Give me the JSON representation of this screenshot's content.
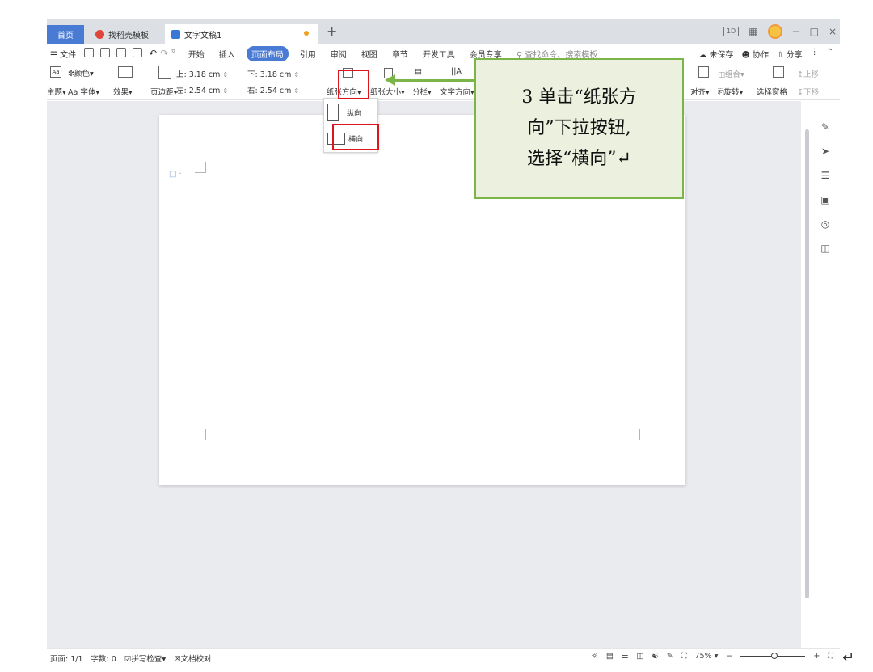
{
  "tabs": {
    "home": "首页",
    "template": "找稻壳模板",
    "document": "文字文稿1",
    "add": "+"
  },
  "window": {
    "layout_label": "1D",
    "grid_icon": "grid-icon",
    "minimize": "−",
    "restore": "□",
    "close": "×"
  },
  "menu": {
    "file": "文件",
    "items": [
      "开始",
      "插入",
      "页面布局",
      "引用",
      "审阅",
      "视图",
      "章节",
      "开发工具",
      "会员专享"
    ],
    "active": "页面布局",
    "search_placeholder": "查找命令、搜索模板",
    "unsaved": "未保存",
    "collaborate": "协作",
    "share": "分享"
  },
  "ribbon": {
    "theme": "主题",
    "color": "颜色",
    "font": "字体",
    "effect": "效果",
    "margins": "页边距",
    "margin_top_label": "上:",
    "margin_top": "3.18 cm",
    "margin_bottom_label": "下:",
    "margin_bottom": "3.18 cm",
    "margin_left_label": "左:",
    "margin_left": "2.54 cm",
    "margin_right_label": "右:",
    "margin_right": "2.54 cm",
    "orientation": "纸张方向",
    "paper_size": "纸张大小",
    "columns": "分栏",
    "text_direction": "文字方向",
    "group": "组合",
    "align": "对齐",
    "rotate": "旋转",
    "selection_pane": "选择窗格",
    "move_up": "上移",
    "move_down": "下移"
  },
  "dropdown": {
    "portrait": "纵向",
    "landscape": "横向"
  },
  "callout": {
    "line1": "3 单击“纸张方",
    "line2": "向”下拉按钮,",
    "line3": "选择“横向”↵"
  },
  "status": {
    "page": "页面: 1/1",
    "word_count": "字数: 0",
    "spell_check": "拼写检查",
    "doc_proof": "文档校对",
    "zoom": "75%",
    "zoom_minus": "−",
    "zoom_plus": "+"
  },
  "return_mark": "↵",
  "colors": {
    "accent_blue": "#4a7bd4",
    "callout_bg": "#ebf1de",
    "callout_border": "#7bb547",
    "highlight_red": "#e0141c"
  }
}
